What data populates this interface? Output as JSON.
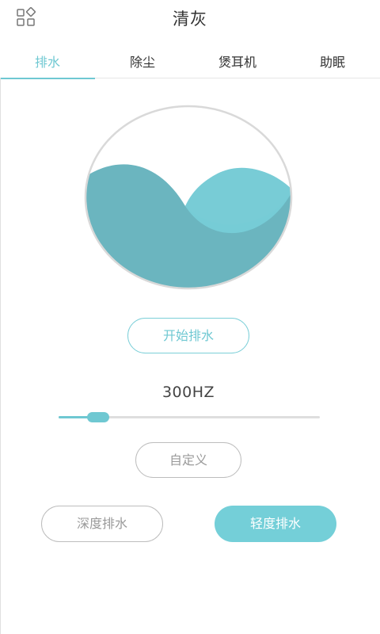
{
  "header": {
    "title": "清灰",
    "menu_icon": "grid-apps-icon"
  },
  "tabs": [
    {
      "label": "排水",
      "active": true
    },
    {
      "label": "除尘",
      "active": false
    },
    {
      "label": "煲耳机",
      "active": false
    },
    {
      "label": "助眠",
      "active": false
    }
  ],
  "colors": {
    "accent": "#6fc8d2",
    "wave_front": "#6bb5bf",
    "wave_back": "#78ccd6",
    "circle_border": "#d9d9d9",
    "button_gray": "#bdbdbd"
  },
  "wave_icon": "water-wave-icon",
  "start_button": {
    "label": "开始排水"
  },
  "frequency": {
    "label": "300HZ",
    "slider_value": 0.15
  },
  "custom_button": {
    "label": "自定义"
  },
  "mode_buttons": {
    "deep_label": "深度排水",
    "light_label": "轻度排水",
    "selected": "light"
  }
}
